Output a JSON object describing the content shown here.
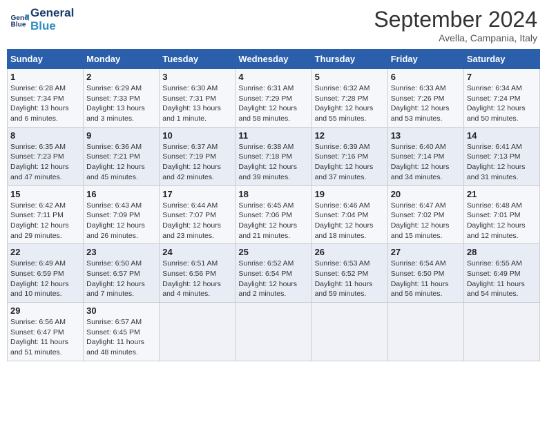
{
  "header": {
    "logo_line1": "General",
    "logo_line2": "Blue",
    "month": "September 2024",
    "location": "Avella, Campania, Italy"
  },
  "days_of_week": [
    "Sunday",
    "Monday",
    "Tuesday",
    "Wednesday",
    "Thursday",
    "Friday",
    "Saturday"
  ],
  "weeks": [
    [
      {
        "day": "1",
        "sunrise": "6:28 AM",
        "sunset": "7:34 PM",
        "daylight": "13 hours and 6 minutes."
      },
      {
        "day": "2",
        "sunrise": "6:29 AM",
        "sunset": "7:33 PM",
        "daylight": "13 hours and 3 minutes."
      },
      {
        "day": "3",
        "sunrise": "6:30 AM",
        "sunset": "7:31 PM",
        "daylight": "13 hours and 1 minute."
      },
      {
        "day": "4",
        "sunrise": "6:31 AM",
        "sunset": "7:29 PM",
        "daylight": "12 hours and 58 minutes."
      },
      {
        "day": "5",
        "sunrise": "6:32 AM",
        "sunset": "7:28 PM",
        "daylight": "12 hours and 55 minutes."
      },
      {
        "day": "6",
        "sunrise": "6:33 AM",
        "sunset": "7:26 PM",
        "daylight": "12 hours and 53 minutes."
      },
      {
        "day": "7",
        "sunrise": "6:34 AM",
        "sunset": "7:24 PM",
        "daylight": "12 hours and 50 minutes."
      }
    ],
    [
      {
        "day": "8",
        "sunrise": "6:35 AM",
        "sunset": "7:23 PM",
        "daylight": "12 hours and 47 minutes."
      },
      {
        "day": "9",
        "sunrise": "6:36 AM",
        "sunset": "7:21 PM",
        "daylight": "12 hours and 45 minutes."
      },
      {
        "day": "10",
        "sunrise": "6:37 AM",
        "sunset": "7:19 PM",
        "daylight": "12 hours and 42 minutes."
      },
      {
        "day": "11",
        "sunrise": "6:38 AM",
        "sunset": "7:18 PM",
        "daylight": "12 hours and 39 minutes."
      },
      {
        "day": "12",
        "sunrise": "6:39 AM",
        "sunset": "7:16 PM",
        "daylight": "12 hours and 37 minutes."
      },
      {
        "day": "13",
        "sunrise": "6:40 AM",
        "sunset": "7:14 PM",
        "daylight": "12 hours and 34 minutes."
      },
      {
        "day": "14",
        "sunrise": "6:41 AM",
        "sunset": "7:13 PM",
        "daylight": "12 hours and 31 minutes."
      }
    ],
    [
      {
        "day": "15",
        "sunrise": "6:42 AM",
        "sunset": "7:11 PM",
        "daylight": "12 hours and 29 minutes."
      },
      {
        "day": "16",
        "sunrise": "6:43 AM",
        "sunset": "7:09 PM",
        "daylight": "12 hours and 26 minutes."
      },
      {
        "day": "17",
        "sunrise": "6:44 AM",
        "sunset": "7:07 PM",
        "daylight": "12 hours and 23 minutes."
      },
      {
        "day": "18",
        "sunrise": "6:45 AM",
        "sunset": "7:06 PM",
        "daylight": "12 hours and 21 minutes."
      },
      {
        "day": "19",
        "sunrise": "6:46 AM",
        "sunset": "7:04 PM",
        "daylight": "12 hours and 18 minutes."
      },
      {
        "day": "20",
        "sunrise": "6:47 AM",
        "sunset": "7:02 PM",
        "daylight": "12 hours and 15 minutes."
      },
      {
        "day": "21",
        "sunrise": "6:48 AM",
        "sunset": "7:01 PM",
        "daylight": "12 hours and 12 minutes."
      }
    ],
    [
      {
        "day": "22",
        "sunrise": "6:49 AM",
        "sunset": "6:59 PM",
        "daylight": "12 hours and 10 minutes."
      },
      {
        "day": "23",
        "sunrise": "6:50 AM",
        "sunset": "6:57 PM",
        "daylight": "12 hours and 7 minutes."
      },
      {
        "day": "24",
        "sunrise": "6:51 AM",
        "sunset": "6:56 PM",
        "daylight": "12 hours and 4 minutes."
      },
      {
        "day": "25",
        "sunrise": "6:52 AM",
        "sunset": "6:54 PM",
        "daylight": "12 hours and 2 minutes."
      },
      {
        "day": "26",
        "sunrise": "6:53 AM",
        "sunset": "6:52 PM",
        "daylight": "11 hours and 59 minutes."
      },
      {
        "day": "27",
        "sunrise": "6:54 AM",
        "sunset": "6:50 PM",
        "daylight": "11 hours and 56 minutes."
      },
      {
        "day": "28",
        "sunrise": "6:55 AM",
        "sunset": "6:49 PM",
        "daylight": "11 hours and 54 minutes."
      }
    ],
    [
      {
        "day": "29",
        "sunrise": "6:56 AM",
        "sunset": "6:47 PM",
        "daylight": "11 hours and 51 minutes."
      },
      {
        "day": "30",
        "sunrise": "6:57 AM",
        "sunset": "6:45 PM",
        "daylight": "11 hours and 48 minutes."
      },
      null,
      null,
      null,
      null,
      null
    ]
  ],
  "labels": {
    "sunrise": "Sunrise:",
    "sunset": "Sunset:",
    "daylight": "Daylight:"
  }
}
